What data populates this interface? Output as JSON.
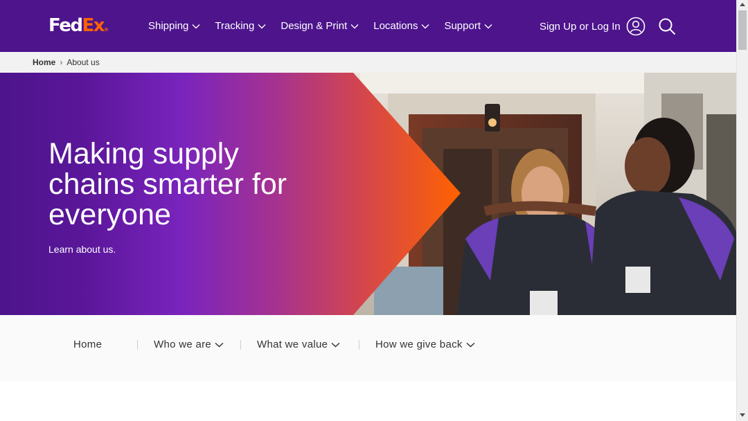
{
  "header": {
    "logo": {
      "fed": "Fed",
      "ex": "Ex",
      "reg": "®"
    },
    "nav": [
      {
        "label": "Shipping"
      },
      {
        "label": "Tracking"
      },
      {
        "label": "Design & Print"
      },
      {
        "label": "Locations"
      },
      {
        "label": "Support"
      }
    ],
    "signin_label": "Sign Up or Log In",
    "icons": {
      "user": "user-circle-icon",
      "search": "search-icon",
      "chevron": "chevron-down-icon"
    },
    "colors": {
      "background": "#4d148c",
      "accent": "#ff6200"
    }
  },
  "breadcrumb": {
    "home": "Home",
    "separator": "›",
    "current": "About us"
  },
  "hero": {
    "title": "Making supply chains smarter for everyone",
    "link": "Learn about us."
  },
  "subnav": {
    "items": [
      {
        "label": "Home"
      },
      {
        "label": "Who we are"
      },
      {
        "label": "What we value"
      },
      {
        "label": "How we give back"
      }
    ]
  }
}
